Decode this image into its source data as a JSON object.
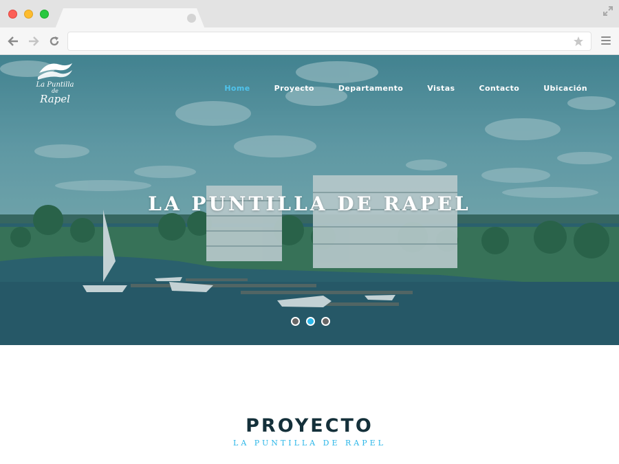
{
  "browser": {
    "colors": {
      "close": "#fc5f57",
      "minimize": "#fdbc2e",
      "maximize": "#28c840"
    },
    "url": ""
  },
  "site": {
    "logo": {
      "line1": "La Puntilla",
      "line2": "de",
      "line3": "Rapel"
    },
    "nav": [
      {
        "label": "Home",
        "active": true
      },
      {
        "label": "Proyecto",
        "active": false
      },
      {
        "label": "Departamento",
        "active": false
      },
      {
        "label": "Vistas",
        "active": false
      },
      {
        "label": "Contacto",
        "active": false
      },
      {
        "label": "Ubicación",
        "active": false
      }
    ],
    "hero": {
      "title": "LA PUNTILLA DE RAPEL",
      "slides": 3,
      "active_slide": 2
    },
    "section": {
      "title": "PROYECTO",
      "subtitle": "LA PUNTILLA DE RAPEL"
    },
    "accent_color": "#29b6e8",
    "title_color": "#14303a"
  }
}
